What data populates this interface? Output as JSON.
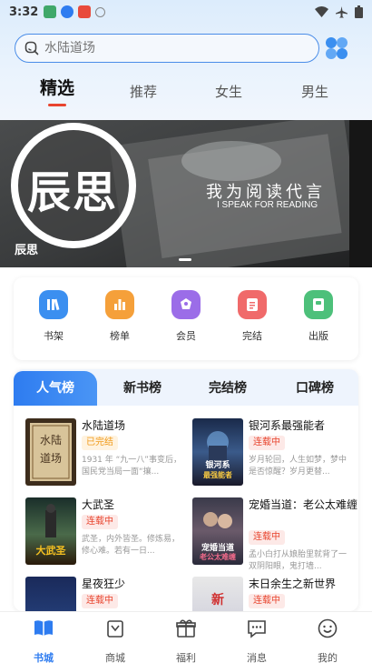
{
  "status_bar": {
    "time": "3:32"
  },
  "search": {
    "placeholder": "水陆道场"
  },
  "top_tabs": [
    {
      "label": "精选",
      "active": true
    },
    {
      "label": "推荐",
      "active": false
    },
    {
      "label": "女生",
      "active": false
    },
    {
      "label": "男生",
      "active": false
    }
  ],
  "banner": {
    "logo_text": "辰思",
    "slogan": "我为阅读代言",
    "slogan_en": "I SPEAK FOR READING",
    "caption": "辰思"
  },
  "categories": [
    {
      "label": "书架",
      "icon": "bookshelf-icon",
      "color": "#3b8ff0"
    },
    {
      "label": "榜单",
      "icon": "chart-icon",
      "color": "#f5a03a"
    },
    {
      "label": "会员",
      "icon": "vip-icon",
      "color": "#9b6de8"
    },
    {
      "label": "完结",
      "icon": "document-icon",
      "color": "#f06a6a"
    },
    {
      "label": "出版",
      "icon": "book-icon",
      "color": "#4dc07a"
    }
  ],
  "ranking": {
    "tabs": [
      "人气榜",
      "新书榜",
      "完结榜",
      "口碑榜"
    ],
    "books": [
      {
        "title": "水陆道场",
        "status": "已完结",
        "desc": "1931 年 “九一八”事变后，国民党当局一面“攘..."
      },
      {
        "title": "银河系最强能者",
        "status": "连载中",
        "desc": "岁月轮回，人生如梦，梦中是否惊醒？岁月更替..."
      },
      {
        "title": "大武圣",
        "status": "连载中",
        "desc": "武圣，内外皆圣。修炼易，修心难。若有一日..."
      },
      {
        "title": "宠婚当道：老公太难缠",
        "status": "连载中",
        "desc": "孟小白打从娘胎里就背了一双阴阳眼，鬼打墙..."
      },
      {
        "title": "星夜狂少",
        "status": "连载中",
        "desc": ""
      },
      {
        "title": "末日余生之新世界",
        "status": "连载中",
        "desc": ""
      }
    ]
  },
  "bottom_nav": [
    {
      "label": "书城",
      "active": true
    },
    {
      "label": "商城",
      "active": false
    },
    {
      "label": "福利",
      "active": false
    },
    {
      "label": "消息",
      "active": false
    },
    {
      "label": "我的",
      "active": false
    }
  ],
  "colors": {
    "accent": "#2e7cf0",
    "tab_underline": "#e8452f"
  }
}
